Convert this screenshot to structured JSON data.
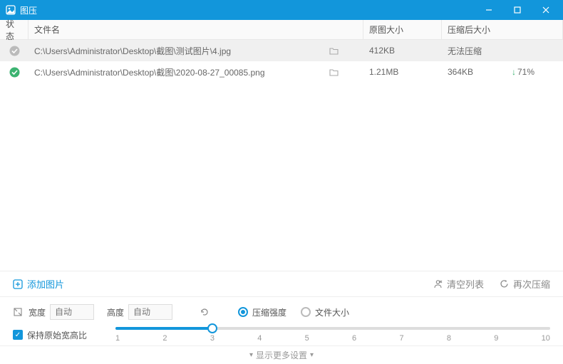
{
  "app": {
    "title": "图压"
  },
  "header": {
    "status": "状态",
    "name": "文件名",
    "orig": "原图大小",
    "comp": "压缩后大小"
  },
  "rows": [
    {
      "status": "gray",
      "name": "C:\\Users\\Administrator\\Desktop\\截图\\测试图片\\4.jpg",
      "orig": "412KB",
      "comp": "无法压缩",
      "pct": "",
      "selected": true
    },
    {
      "status": "ok",
      "name": "C:\\Users\\Administrator\\Desktop\\截图\\2020-08-27_00085.png",
      "orig": "1.21MB",
      "comp": "364KB",
      "pct": "71%",
      "selected": false
    }
  ],
  "actions": {
    "add": "添加图片",
    "clear": "清空列表",
    "recompress": "再次压缩"
  },
  "dims": {
    "width_label": "宽度",
    "height_label": "高度",
    "placeholder": "自动",
    "keep_ratio": "保持原始宽高比"
  },
  "mode": {
    "strength": "压缩强度",
    "filesize": "文件大小"
  },
  "slider": {
    "min": 1,
    "max": 10,
    "value": 3,
    "ticks": [
      "1",
      "2",
      "3",
      "4",
      "5",
      "6",
      "7",
      "8",
      "9",
      "10"
    ]
  },
  "footer": {
    "more": "显示更多设置"
  }
}
